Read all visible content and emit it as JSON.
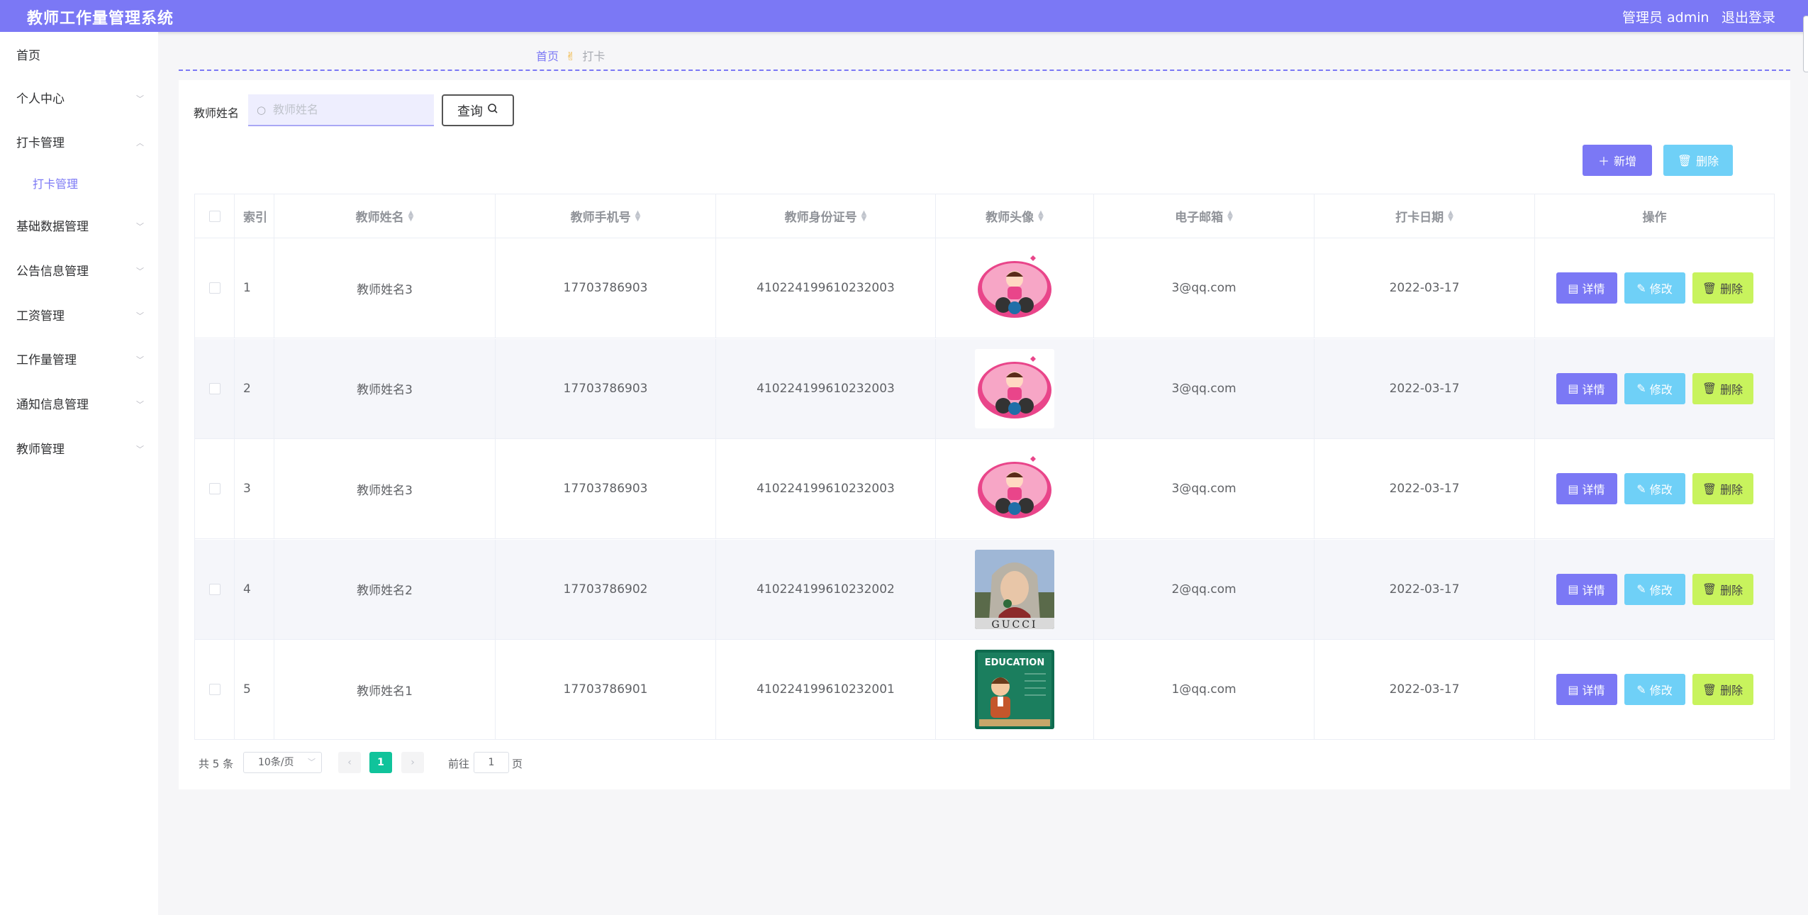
{
  "app": {
    "title": "教师工作量管理系统",
    "user": "管理员 admin",
    "logout": "退出登录"
  },
  "sidebar": {
    "items": [
      {
        "label": "首页",
        "arrow": ""
      },
      {
        "label": "个人中心",
        "arrow": "﹀"
      },
      {
        "label": "打卡管理",
        "arrow": "︿"
      },
      {
        "label": "打卡管理",
        "arrow": ""
      },
      {
        "label": "基础数据管理",
        "arrow": "﹀"
      },
      {
        "label": "公告信息管理",
        "arrow": "﹀"
      },
      {
        "label": "工资管理",
        "arrow": "﹀"
      },
      {
        "label": "工作量管理",
        "arrow": "﹀"
      },
      {
        "label": "通知信息管理",
        "arrow": "﹀"
      },
      {
        "label": "教师管理",
        "arrow": "﹀"
      }
    ]
  },
  "breadcrumb": {
    "home": "首页",
    "current": "打卡"
  },
  "search": {
    "label": "教师姓名",
    "placeholder": "教师姓名",
    "button": "查询"
  },
  "actions": {
    "add": "新增",
    "delete": "删除"
  },
  "table": {
    "headers": {
      "index": "索引",
      "name": "教师姓名",
      "phone": "教师手机号",
      "idcard": "教师身份证号",
      "avatar": "教师头像",
      "email": "电子邮箱",
      "date": "打卡日期",
      "ops": "操作"
    },
    "rows": [
      {
        "index": "1",
        "name": "教师姓名3",
        "phone": "17703786903",
        "idcard": "410224199610232003",
        "email": "3@qq.com",
        "date": "2022-03-17",
        "avatar": "cartoon-girl"
      },
      {
        "index": "2",
        "name": "教师姓名3",
        "phone": "17703786903",
        "idcard": "410224199610232003",
        "email": "3@qq.com",
        "date": "2022-03-17",
        "avatar": "cartoon-girl"
      },
      {
        "index": "3",
        "name": "教师姓名3",
        "phone": "17703786903",
        "idcard": "410224199610232003",
        "email": "3@qq.com",
        "date": "2022-03-17",
        "avatar": "cartoon-girl"
      },
      {
        "index": "4",
        "name": "教师姓名2",
        "phone": "17703786902",
        "idcard": "410224199610232002",
        "email": "2@qq.com",
        "date": "2022-03-17",
        "avatar": "photo-woman"
      },
      {
        "index": "5",
        "name": "教师姓名1",
        "phone": "17703786901",
        "idcard": "410224199610232001",
        "email": "1@qq.com",
        "date": "2022-03-17",
        "avatar": "education-teacher"
      }
    ],
    "ops": {
      "detail": "详情",
      "edit": "修改",
      "remove": "删除"
    }
  },
  "avatar_text": {
    "gucci": "GUCCI",
    "education": "EDUCATION"
  },
  "pagination": {
    "total": "共 5 条",
    "page_size": "10条/页",
    "prev": "‹",
    "next": "›",
    "current_page": "1",
    "goto_label": "前往",
    "goto_value": "1",
    "goto_unit": "页"
  },
  "colors": {
    "primary": "#7b78f5",
    "info": "#6fd0f7",
    "warn": "#c8f35d",
    "pager": "#10c39b"
  }
}
